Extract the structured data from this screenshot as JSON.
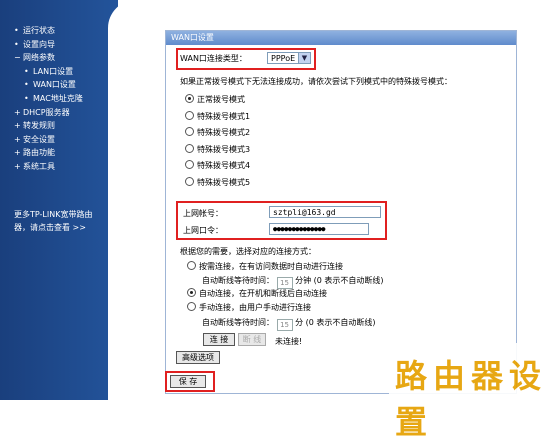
{
  "sidebar": {
    "items": [
      {
        "marker": "•",
        "label": "运行状态"
      },
      {
        "marker": "•",
        "label": "设置向导"
      },
      {
        "marker": "−",
        "label": "网络参数"
      },
      {
        "marker": "•",
        "label": "LAN口设置"
      },
      {
        "marker": "•",
        "label": "WAN口设置"
      },
      {
        "marker": "•",
        "label": "MAC地址克隆"
      },
      {
        "marker": "+",
        "label": "DHCP服务器"
      },
      {
        "marker": "+",
        "label": "转发规则"
      },
      {
        "marker": "+",
        "label": "安全设置"
      },
      {
        "marker": "+",
        "label": "路由功能"
      },
      {
        "marker": "+",
        "label": "系统工具"
      }
    ],
    "more_line1": "更多TP-LINK宽带路由",
    "more_line2": "器，请点击查看 >>"
  },
  "panel": {
    "title": "WAN口设置",
    "wan_type_label": "WAN口连接类型：",
    "wan_type_value": "PPPoE",
    "special_hint": "如果正常拨号模式下无法连接成功，请依次尝试下列模式中的特殊拨号模式：",
    "dial_modes": [
      "正常拨号模式",
      "特殊拨号模式1",
      "特殊拨号模式2",
      "特殊拨号模式3",
      "特殊拨号模式4",
      "特殊拨号模式5"
    ],
    "account_label": "上网帐号：",
    "account_value": "sztpli@163.gd",
    "password_label": "上网口令：",
    "password_value": "●●●●●●●●●●●●●●",
    "conn_hint": "根据您的需要，选择对应的连接方式：",
    "on_demand": "按需连接，在有访问数据时自动进行连接",
    "idle_label": "自动断线等待时间：",
    "idle_value1": "15",
    "idle_unit1": "分钟 (0 表示不自动断线)",
    "auto_connect": "自动连接，在开机和断线后自动连接",
    "manual_connect": "手动连接，由用户手动进行连接",
    "idle_value2": "15",
    "idle_unit2": "分 (0 表示不自动断线)",
    "connect_button": "连 接",
    "disconnect_button": "断 线",
    "status_text": "未连接!",
    "advanced_button": "高级选项",
    "save_button": "保 存"
  },
  "watermark": "路由器设置"
}
